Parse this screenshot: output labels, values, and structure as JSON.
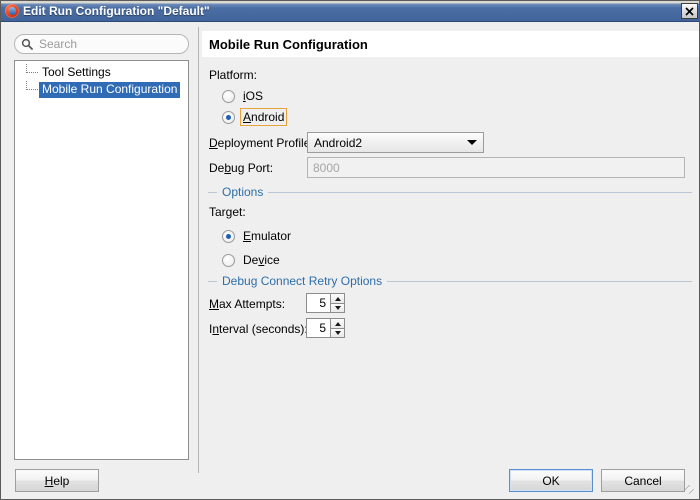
{
  "window": {
    "title": "Edit Run Configuration \"Default\"",
    "icon": "jdeveloper-icon",
    "close_label": "close-icon",
    "titlebar_color": "#41659b"
  },
  "search": {
    "placeholder": "Search",
    "value": "",
    "icon": "search-icon"
  },
  "tree": {
    "items": [
      {
        "label": "Tool Settings",
        "selected": false
      },
      {
        "label": "Mobile Run Configuration",
        "selected": true
      }
    ],
    "selection_color": "#2f6cb5"
  },
  "panel": {
    "title": "Mobile Run Configuration",
    "platform_label": "Platform:",
    "platform_options": [
      {
        "label": "iOS",
        "mnemonic": "i",
        "selected": false,
        "focused": false
      },
      {
        "label": "Android",
        "mnemonic": "A",
        "selected": true,
        "focused": true
      }
    ],
    "deployment_profile": {
      "label": "Deployment Profile:",
      "mnemonic": "D",
      "value": "Android2",
      "options": [
        "Android2"
      ]
    },
    "debug_port": {
      "label": "Debug Port:",
      "mnemonic": "b",
      "value": "8000",
      "enabled": false
    },
    "options_group": {
      "title": "Options",
      "target_label": "Target:",
      "target_options": [
        {
          "label": "Emulator",
          "mnemonic": "E",
          "selected": true
        },
        {
          "label": "Device",
          "mnemonic": "v",
          "selected": false
        }
      ]
    },
    "retry_group": {
      "title": "Debug Connect Retry Options",
      "fields": [
        {
          "label": "Max Attempts:",
          "mnemonic": "M",
          "value": "5"
        },
        {
          "label": "Interval (seconds):",
          "mnemonic": "n",
          "value": "5"
        }
      ]
    },
    "group_label_color": "#2e6ea8"
  },
  "footer": {
    "help_label": "Help",
    "ok_label": "OK",
    "cancel_label": "Cancel",
    "default_button": "OK"
  }
}
